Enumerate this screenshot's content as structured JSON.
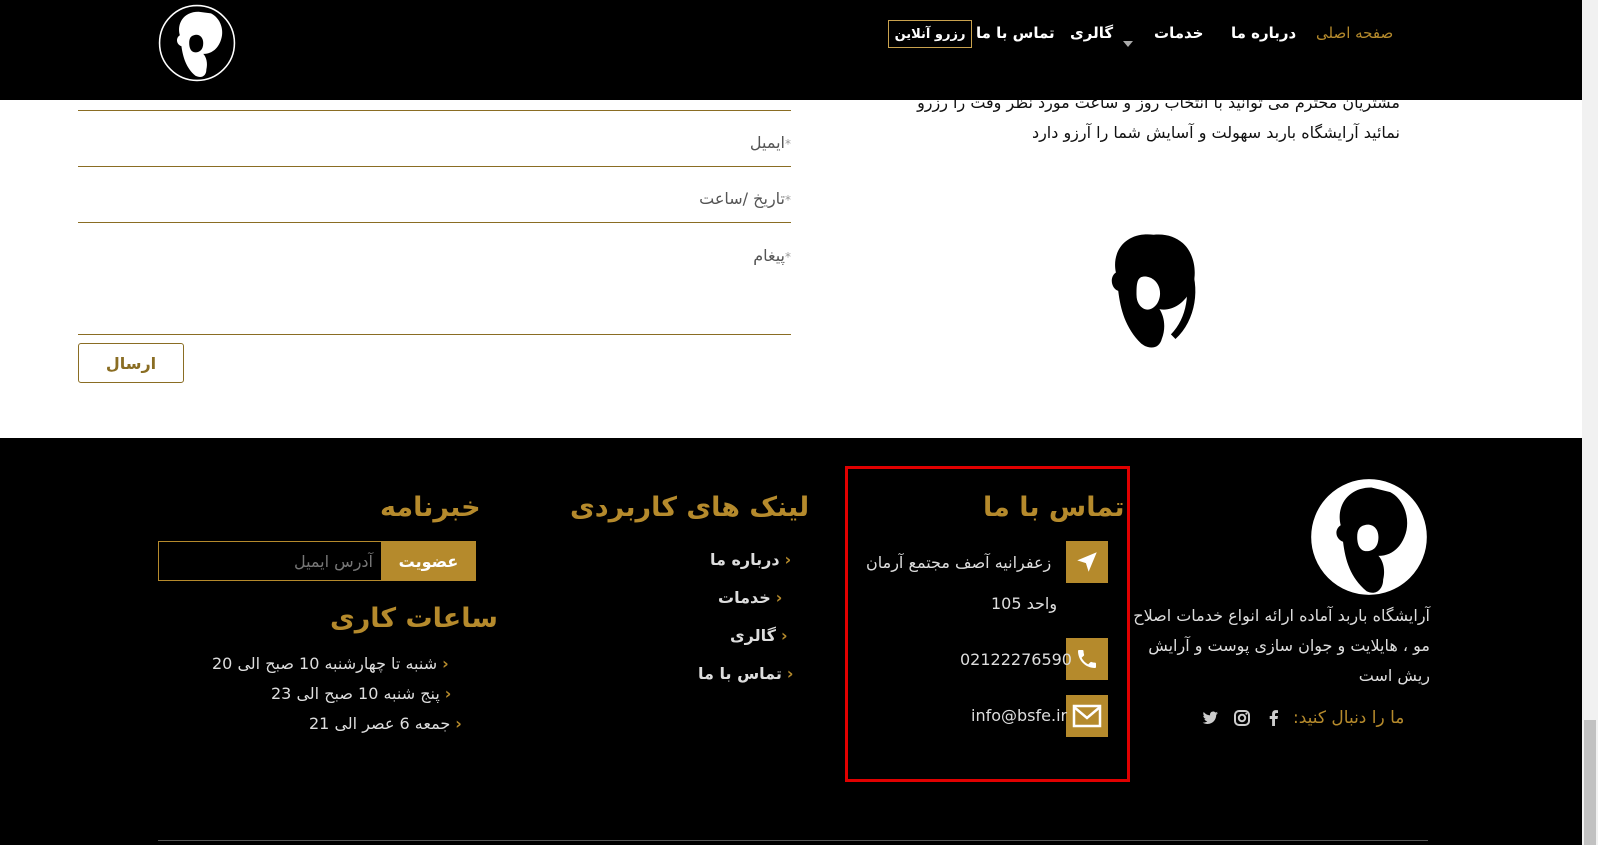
{
  "header": {
    "nav": [
      {
        "label": "صفحه اصلی",
        "active": true
      },
      {
        "label": "درباره ما"
      },
      {
        "label": "خدمات"
      },
      {
        "label": "گالری"
      },
      {
        "label": "تماس با ما"
      }
    ],
    "reserve_label": "رزرو آنلاین"
  },
  "form": {
    "intro_line1": "مشتریان محترم می توانید با انتخاب روز و ساعت مورد نظر وقت را رزرو",
    "intro_line2": "نمائید آرایشگاه باربد سهولت و آسایش شما را آرزو دارد",
    "email_label": "ایمیل",
    "datetime_label": "تاریخ /ساعت",
    "message_label": "پیغام",
    "required_mark": "*",
    "submit_label": "ارسال"
  },
  "footer": {
    "about_text": "آرایشگاه باربد آماده ارائه انواع خدمات اصلاح مو ، هایلایت و جوان سازی پوست و آرایش ریش است",
    "follow_label": "ما را دنبال کنید:",
    "contact": {
      "title": "تماس با ما",
      "address_line1": "زعفرانیه آصف مجتمع آرمان",
      "address_line2": "واحد 105",
      "phone": "02122276590",
      "email": "info@bsfe.ir"
    },
    "links": {
      "title": "لینک های کاربردی",
      "items": [
        "درباره ما",
        "خدمات",
        "گالری",
        "تماس با ما"
      ]
    },
    "newsletter": {
      "title": "خبرنامه",
      "placeholder": "آدرس ایمیل",
      "button": "عضویت"
    },
    "hours": {
      "title": "ساعات کاری",
      "items": [
        "شنبه تا چهارشنبه 10 صبح الی 20",
        "پنج شنبه 10 صبح الی 23",
        "جمعه 6 عصر الی 21"
      ]
    }
  },
  "colors": {
    "accent": "#b58a2c",
    "highlight_box": "#e00000"
  },
  "icons": [
    "bearded-man-logo",
    "location-arrow-icon",
    "phone-icon",
    "envelope-icon",
    "facebook-icon",
    "instagram-icon",
    "twitter-icon",
    "chevron-icon",
    "caret-down-icon"
  ]
}
